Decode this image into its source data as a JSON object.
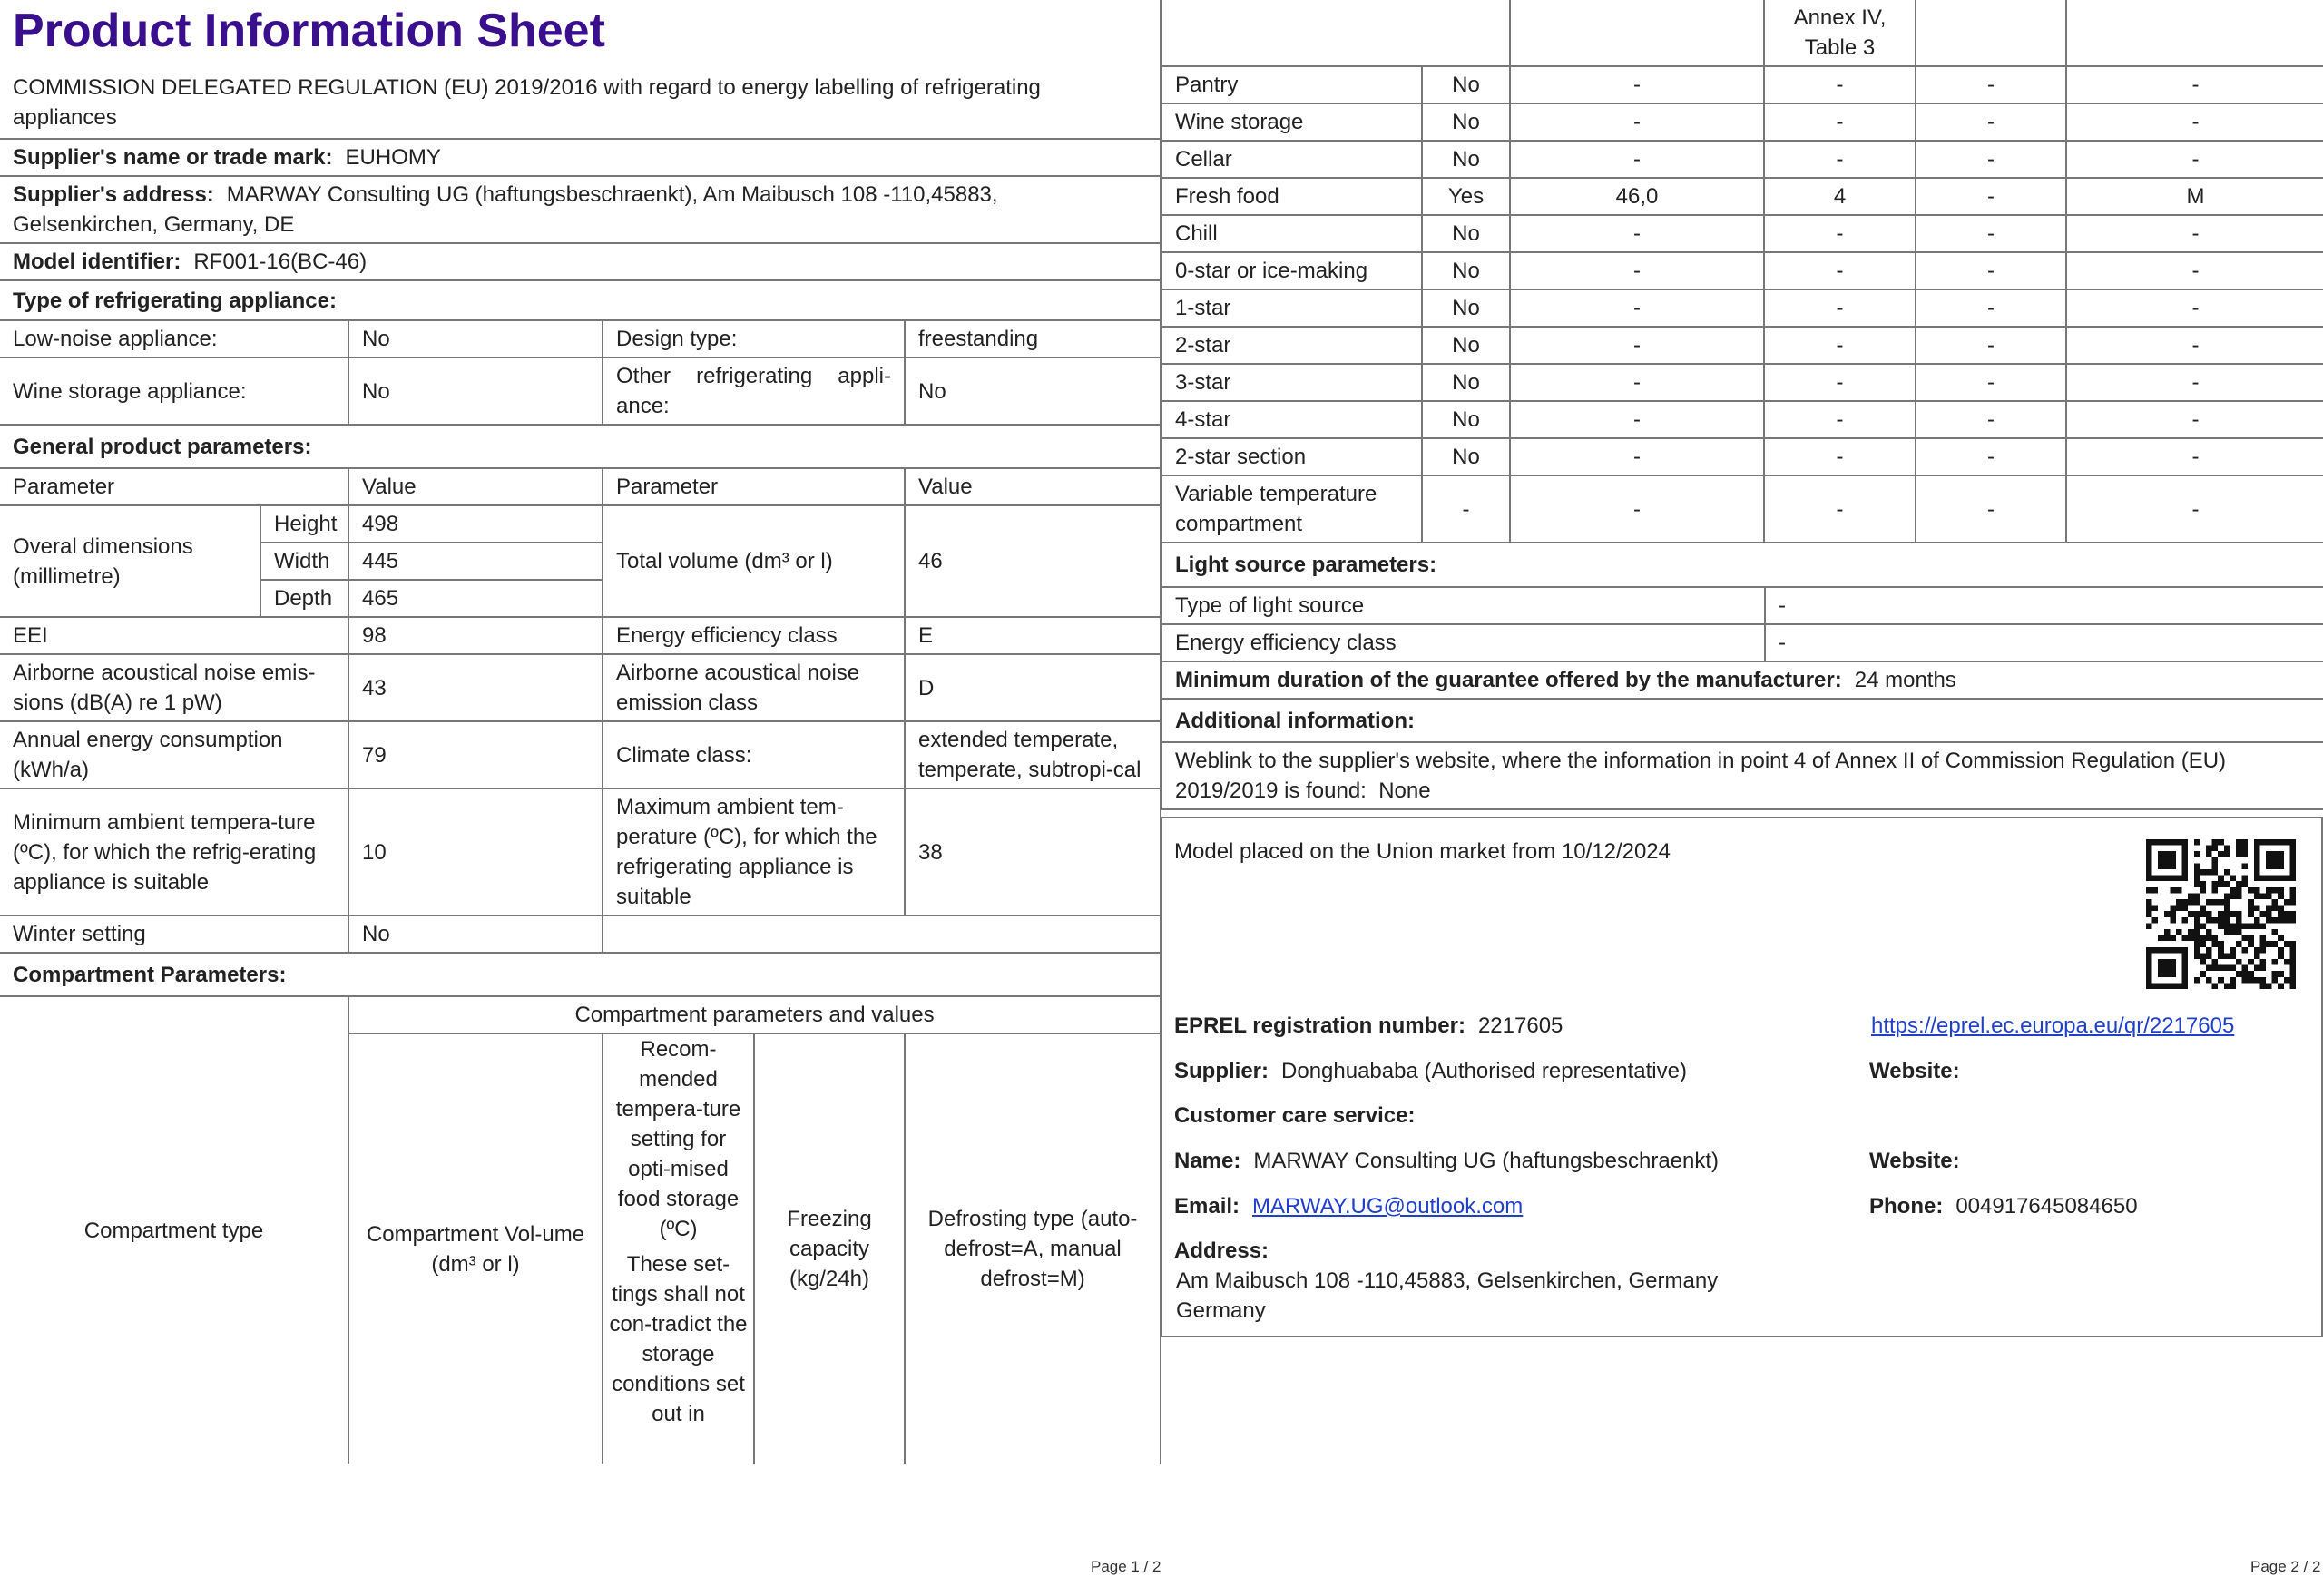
{
  "header": {
    "title": "Product Information Sheet",
    "regulation": "COMMISSION DELEGATED REGULATION (EU) 2019/2016 with regard to energy labelling of refrigerating appliances"
  },
  "supplier": {
    "name_label": "Supplier's name or trade mark:",
    "name_value": "EUHOMY",
    "address_label": "Supplier's address:",
    "address_value": "MARWAY Consulting UG (haftungsbeschraenkt), Am Maibusch 108 -110,45883, Gelsenkirchen, Germany, DE",
    "model_label": "Model identifier:",
    "model_value": "RF001-16(BC-46)"
  },
  "appliance_type": {
    "heading": "Type of refrigerating appliance:",
    "low_noise_label": "Low-noise appliance:",
    "low_noise_value": "No",
    "design_label": "Design type:",
    "design_value": "freestanding",
    "wine_label": "Wine storage appliance:",
    "wine_value": "No",
    "other_label": "Other refrigerating appli-ance:",
    "other_value": "No"
  },
  "general": {
    "heading": "General product parameters:",
    "col_param": "Parameter",
    "col_value": "Value",
    "dims_label": "Overal dimensions (millimetre)",
    "height_label": "Height",
    "height_value": "498",
    "width_label": "Width",
    "width_value": "445",
    "depth_label": "Depth",
    "depth_value": "465",
    "volume_label": "Total volume (dm³ or l)",
    "volume_value": "46",
    "eei_label": "EEI",
    "eei_value": "98",
    "eclass_label": "Energy efficiency class",
    "eclass_value": "E",
    "noise_label": "Airborne acoustical noise emis-sions (dB(A) re 1 pW)",
    "noise_value": "43",
    "noise_class_label": "Airborne acoustical noise emission class",
    "noise_class_value": "D",
    "annual_label": "Annual energy consumption (kWh/a)",
    "annual_value": "79",
    "climate_label": "Climate class:",
    "climate_value": "extended temperate, temperate, subtropi-cal",
    "min_temp_label": "Minimum ambient tempera-ture (ºC), for which the refrig-erating appliance is suitable",
    "min_temp_value": "10",
    "max_temp_label": "Maximum ambient tem-perature (ºC), for which the refrigerating appliance is suitable",
    "max_temp_value": "38",
    "winter_label": "Winter setting",
    "winter_value": "No"
  },
  "compartment": {
    "heading": "Compartment Parameters:",
    "group_header": "Compartment parameters and values",
    "col_type": "Compartment type",
    "col_volume": "Compartment Vol-ume (dm³ or l)",
    "col_temp_a": "Recom-mended tempera-ture setting for opti-mised food storage (ºC)",
    "col_temp_b": "These set-tings shall not con-tradict the storage conditions set out in",
    "col_temp_c": "Annex IV, Table 3",
    "col_freezing": "Freezing capacity (kg/24h)",
    "col_defrost": "Defrosting type (auto-defrost=A, manual defrost=M)",
    "rows": [
      [
        "Pantry",
        "No",
        "-",
        "-",
        "-",
        "-"
      ],
      [
        "Wine storage",
        "No",
        "-",
        "-",
        "-",
        "-"
      ],
      [
        "Cellar",
        "No",
        "-",
        "-",
        "-",
        "-"
      ],
      [
        "Fresh food",
        "Yes",
        "46,0",
        "4",
        "-",
        "M"
      ],
      [
        "Chill",
        "No",
        "-",
        "-",
        "-",
        "-"
      ],
      [
        "0-star or ice-making",
        "No",
        "-",
        "-",
        "-",
        "-"
      ],
      [
        "1-star",
        "No",
        "-",
        "-",
        "-",
        "-"
      ],
      [
        "2-star",
        "No",
        "-",
        "-",
        "-",
        "-"
      ],
      [
        "3-star",
        "No",
        "-",
        "-",
        "-",
        "-"
      ],
      [
        "4-star",
        "No",
        "-",
        "-",
        "-",
        "-"
      ],
      [
        "2-star section",
        "No",
        "-",
        "-",
        "-",
        "-"
      ],
      [
        "Variable temperature compartment",
        "-",
        "-",
        "-",
        "-",
        "-"
      ]
    ]
  },
  "light": {
    "heading": "Light source parameters:",
    "type_label": "Type of light source",
    "type_value": "-",
    "class_label": "Energy efficiency class",
    "class_value": "-"
  },
  "guarantee": {
    "label": "Minimum duration of the guarantee offered by the manufacturer:",
    "value": "24 months"
  },
  "additional": {
    "heading": "Additional information:",
    "weblink_text": "Weblink to the supplier's website, where the information in point 4 of Annex II of Commission Regulation (EU) 2019/2019 is found:",
    "weblink_value": "None"
  },
  "market": {
    "placed_text": "Model placed on the Union market from 10/12/2024",
    "eprel_label": "EPREL registration number:",
    "eprel_value": "2217605",
    "eprel_link": "https://eprel.ec.europa.eu/qr/2217605",
    "supplier_label": "Supplier:",
    "supplier_value": "Donghuababa (Authorised representative)",
    "website_label": "Website:",
    "care_heading": "Customer care service:",
    "name_label": "Name:",
    "name_value": "MARWAY Consulting UG (haftungsbeschraenkt)",
    "care_website_label": "Website:",
    "email_label": "Email:",
    "email_value": "MARWAY.UG@outlook.com",
    "phone_label": "Phone:",
    "phone_value": "004917645084650",
    "address_label": "Address:",
    "address_line1": "Am Maibusch 108 -110,45883, Gelsenkirchen, Germany",
    "address_line2": "Germany"
  },
  "footer": {
    "page1": "Page 1 / 2",
    "page2": "Page 2 / 2"
  },
  "icons": {
    "qr": "qr-code-icon"
  }
}
